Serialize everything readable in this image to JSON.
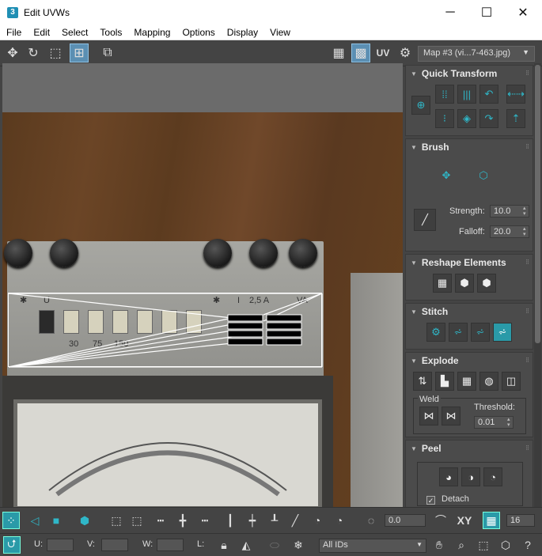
{
  "window": {
    "app_icon": "3",
    "title": "Edit UVWs",
    "minimize": "─",
    "maximize": "☐",
    "close": "✕"
  },
  "menu": [
    "File",
    "Edit",
    "Select",
    "Tools",
    "Mapping",
    "Options",
    "Display",
    "View"
  ],
  "toolbar": {
    "uv_label": "UV",
    "map_select": "Map #3 (vi...7-463.jpg)"
  },
  "plate": {
    "asterisk1": "✱",
    "u": "U",
    "asterisk2": "✱",
    "bar": "I",
    "amp": "2,5 A",
    "va": "VA",
    "n30": "30",
    "n75": "75",
    "n150": "150"
  },
  "panel": {
    "quick_transform": "Quick Transform",
    "brush": "Brush",
    "strength_label": "Strength:",
    "strength_value": "10.0",
    "falloff_label": "Falloff:",
    "falloff_value": "20.0",
    "reshape": "Reshape Elements",
    "stitch": "Stitch",
    "explode": "Explode",
    "weld": "Weld",
    "threshold_label": "Threshold:",
    "threshold_value": "0.01",
    "peel": "Peel",
    "detach": "Detach"
  },
  "bottom": {
    "rotate_value": "0.0",
    "xy": "XY",
    "count": "16",
    "u_label": "U:",
    "v_label": "V:",
    "w_label": "W:",
    "l_label": "L:",
    "ids_select": "All IDs"
  },
  "colors": {
    "accent": "#2fb7c8",
    "panel_bg": "#444444",
    "highlight": "#2a9aa8"
  }
}
